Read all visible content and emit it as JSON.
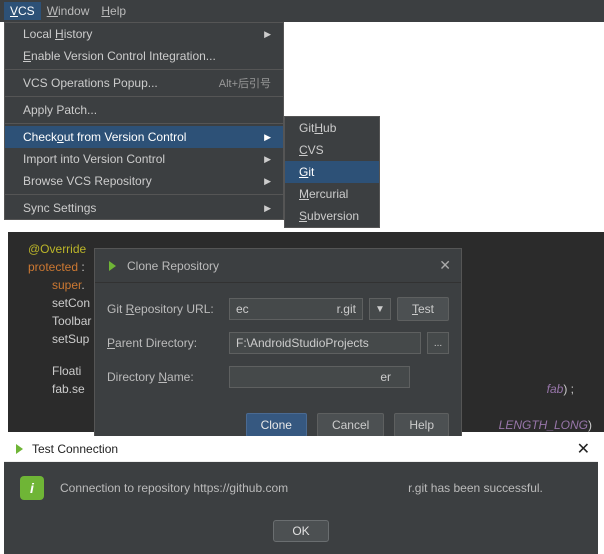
{
  "menubar": {
    "vcs": "VCS",
    "window": "Window",
    "help": "Help"
  },
  "helpGlyph": "?",
  "dd1": {
    "local_history": "Local History",
    "enable_vci": "Enable Version Control Integration...",
    "ops_popup": "VCS Operations Popup...",
    "ops_shortcut": "Alt+后引号",
    "apply_patch": "Apply Patch...",
    "checkout": "Checkout from Version Control",
    "import": "Import into Version Control",
    "browse": "Browse VCS Repository",
    "sync": "Sync Settings"
  },
  "dd2": {
    "github": "GitHub",
    "cvs": "CVS",
    "git": "Git",
    "mercurial": "Mercurial",
    "subversion": "Subversion"
  },
  "code": {
    "l1a": "@Override",
    "l2a": "protected",
    "l2b": " :",
    "l3a": "super",
    "l3b": ".",
    "l4": "setCon",
    "l5": "Toolbar",
    "l6": "setSup",
    "l7": "Floati",
    "l8a": "fab.se",
    "l8b": "fab",
    "l8c": ") ;",
    "l9a": "LENGTH_LONG",
    "l9b": ")"
  },
  "dialog": {
    "title": "Clone Repository",
    "url_label": "Git Repository URL:",
    "url_left": "ec",
    "url_right": "r.git",
    "test": "Test",
    "parent_label": "Parent Directory:",
    "parent_value": "F:\\AndroidStudioProjects",
    "browse": "...",
    "dir_label": "Directory Name:",
    "dir_value": "er",
    "clone": "Clone",
    "cancel": "Cancel",
    "help": "Help"
  },
  "tc": {
    "title": "Test Connection",
    "msg_a": "Connection to repository https://github.com",
    "msg_b": "r.git has been successful.",
    "ok": "OK"
  }
}
